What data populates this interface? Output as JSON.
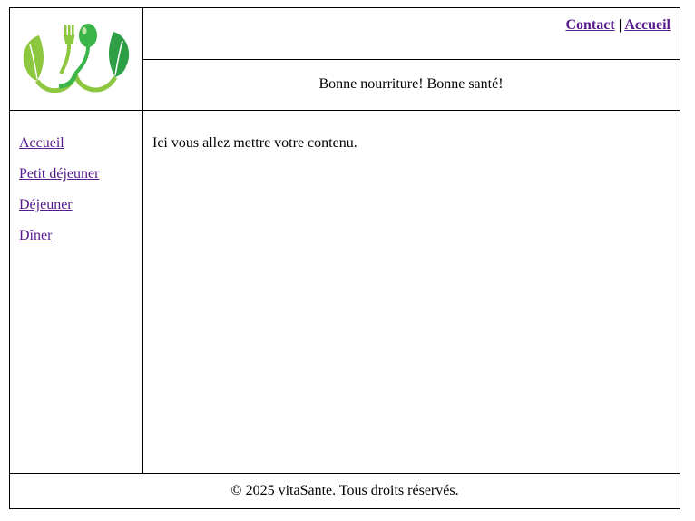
{
  "header": {
    "logo": {
      "icon": "leaf-fork-spoon-logo-icon",
      "colors": [
        "#8dc63f",
        "#39b54a",
        "#2e9e44"
      ]
    },
    "nav": [
      {
        "label": "Contact"
      },
      {
        "separator": "|"
      },
      {
        "label": "Accueil"
      }
    ],
    "slogan": "Bonne nourriture! Bonne santé!"
  },
  "sidebar": {
    "items": [
      {
        "label": "Accueil"
      },
      {
        "label": "Petit déjeuner"
      },
      {
        "label": "Déjeuner"
      },
      {
        "label": "Dîner"
      }
    ]
  },
  "main": {
    "text": "Ici vous allez mettre votre contenu."
  },
  "footer": {
    "text": "© 2025 vitaSante. Tous droits réservés."
  },
  "colors": {
    "link": "#551a8b",
    "border": "#000000"
  }
}
